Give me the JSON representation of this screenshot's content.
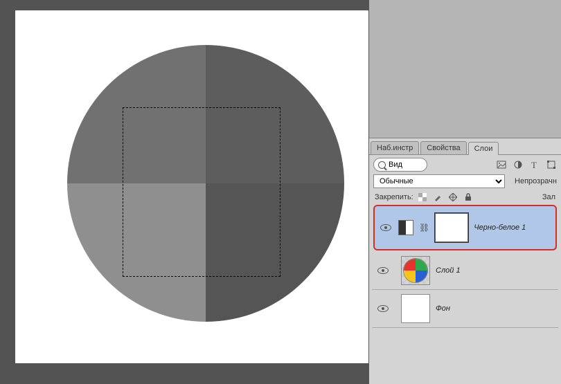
{
  "tabs": {
    "toolset": "Наб.инстр",
    "properties": "Свойства",
    "layers": "Слои"
  },
  "search": {
    "value": "Вид"
  },
  "blend": {
    "mode": "Обычные",
    "opacity_label": "Непрозрачн"
  },
  "lock": {
    "label": "Закрепить:",
    "fill_label": "Зал"
  },
  "layers": [
    {
      "name": "Черно-белое 1",
      "type": "adjustment",
      "selected": true
    },
    {
      "name": "Слой 1",
      "type": "color-circle",
      "selected": false
    },
    {
      "name": "Фон",
      "type": "background",
      "selected": false
    }
  ]
}
